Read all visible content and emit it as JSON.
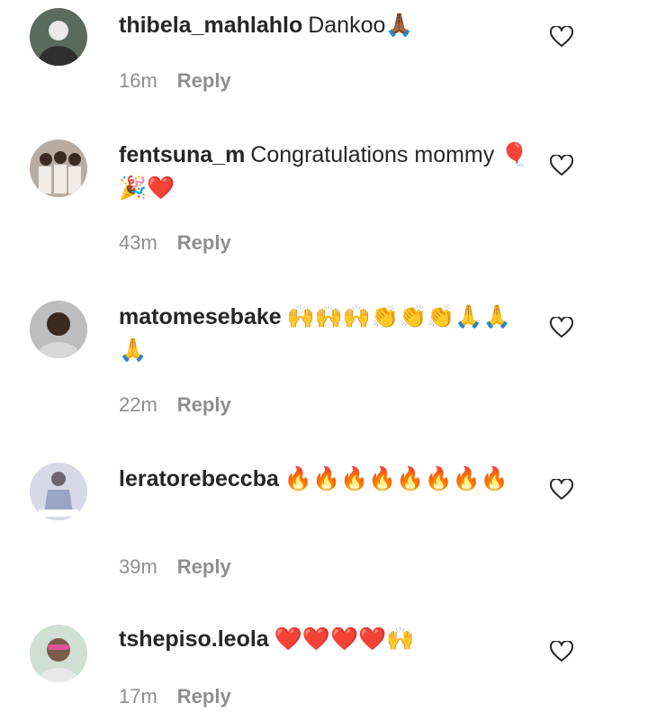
{
  "comments": [
    {
      "username": "thibela_mahlahlo",
      "text": "Dankoo🙏🏾",
      "time": "16m",
      "reply_label": "Reply",
      "avatar_bg": "#5b6a5e",
      "avatar_fg": "#e9e9e9"
    },
    {
      "username": "fentsuna_m",
      "text": "Congratulations mommy 🎈🎉❤️",
      "time": "43m",
      "reply_label": "Reply",
      "avatar_bg": "#b8aca2",
      "avatar_fg": "#f1ece8"
    },
    {
      "username": "matomesebake",
      "text": "🙌🙌🙌👏👏👏🙏🙏🙏",
      "time": "22m",
      "reply_label": "Reply",
      "avatar_bg": "#bdbdbd",
      "avatar_fg": "#3a2a22"
    },
    {
      "username": "leratorebeccba",
      "text": "🔥🔥🔥🔥🔥🔥🔥🔥",
      "time": "39m",
      "reply_label": "Reply",
      "avatar_bg": "#d7d9e6",
      "avatar_fg": "#6d6670"
    },
    {
      "username": "tshepiso.leola",
      "text": "❤️❤️❤️❤️🙌",
      "time": "17m",
      "reply_label": "Reply",
      "avatar_bg": "#cfe0d2",
      "avatar_fg": "#7a5b4d"
    }
  ]
}
